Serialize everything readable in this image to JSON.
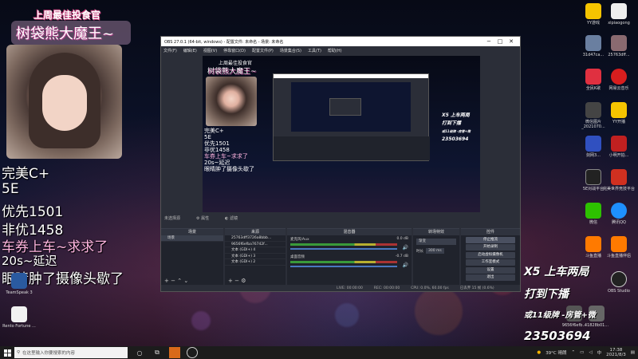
{
  "overlay": {
    "title": "上周最佳投食官",
    "name": "树袋熊大魔王~",
    "lines": [
      "完美C+",
      "5E",
      "优先1501",
      "非优1458",
      "车券上车~求求了",
      "20s~延迟",
      "眼睛肿了摄像头歇了"
    ]
  },
  "right_overlay": {
    "x5": "X5  上车两局",
    "daodan": "打到下播",
    "kuiao": "或11级牌 -房管+微",
    "qq": "23503694"
  },
  "desktop_icons": {
    "yy": "YY游戏",
    "xipiaogong": "xipiaogong",
    "file1": "31d47ca...",
    "file2": "25763dff...",
    "qmk": "全民K歌",
    "wyy": "网易云音乐",
    "wechatimg": "微信图片_2021070...",
    "yylive": "YY开播",
    "ww": "剑网3...",
    "xiaoming": "小明开拍...",
    "5e": "5E对战平台",
    "perfect": "完美世界竞技平台",
    "wechat": "微信",
    "qq": "腾讯QQ",
    "douyu1": "斗鱼直播",
    "douyu2": "斗鱼直播伴侣",
    "f9656": "9656f6efb...",
    "f41828": "41828b01...",
    "obs": "OBS Studio",
    "teamspeak": "TeamSpeak 3",
    "rento": "Rento Fortune ..."
  },
  "obs": {
    "title": "OBS 27.0.1 (64-bit, windows) - 配置文件: 未命名 - 场景: 未命名",
    "menu": [
      "文件(F)",
      "编辑(E)",
      "视图(V)",
      "停靠窗口(D)",
      "配置文件(P)",
      "场景集合(S)",
      "工具(T)",
      "帮助(H)"
    ],
    "toolbar": {
      "no_source": "未选择源",
      "props": "属性",
      "filters": "滤镜"
    },
    "docks": {
      "scenes": "场景",
      "sources": "来源",
      "mixer": "混音器",
      "transitions": "转场特效",
      "controls": "控件"
    },
    "scene_item": "场景",
    "sources": [
      "25763dff3726a8bbb...",
      "9656f6efba76742f...",
      "文本 (GDI+) 4",
      "文本 (GDI+) 3",
      "文本 (GDI+) 2"
    ],
    "mixer": [
      {
        "name": "麦克风/Aux",
        "db": "0.0 dB"
      },
      {
        "name": "桌面音频",
        "db": "-0.7 dB"
      }
    ],
    "transitions": {
      "type": "渐变",
      "duration_label": "时长",
      "duration": "300 ms"
    },
    "controls": [
      "停止推流",
      "开始录制",
      "启动虚拟摄像机",
      "工作室模式",
      "设置",
      "退出"
    ],
    "status": {
      "live": "LIVE: 00:00:00",
      "rec": "REC: 00:00:00",
      "cpu": "CPU: 0.0%, 60.00 fps",
      "frames": "已丢弃 15 帧 (0.6%)"
    },
    "add": "+",
    "remove": "−"
  },
  "taskbar": {
    "search_placeholder": "在这里输入你要搜索的内容",
    "weather": "39°C 晴朗",
    "time": "17:38",
    "date": "2021/8/3"
  }
}
